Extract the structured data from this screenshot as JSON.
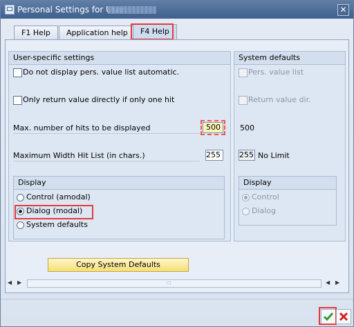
{
  "window": {
    "title": "Personal Settings for User",
    "close_glyph": "✕"
  },
  "tabs": [
    {
      "label": "F1 Help"
    },
    {
      "label": "Application help"
    },
    {
      "label": "F4 Help"
    }
  ],
  "user_settings": {
    "heading": "User-specific settings",
    "no_list_auto": "Do not display pers. value list automatic.",
    "return_directly": "Only return value directly if only one hit",
    "max_hits_label": "Max. number of hits to be displayed",
    "max_hits_value": "500",
    "max_width_label": "Maximum Width Hit List (in chars.)",
    "max_width_value": "255",
    "display": {
      "heading": "Display",
      "options": [
        "Control (amodal)",
        "Dialog (modal)",
        "System defaults"
      ],
      "selected": "Dialog (modal)"
    },
    "copy_button": "Copy System Defaults"
  },
  "system_defaults": {
    "heading": "System defaults",
    "pers_value_list": "Pers. value list",
    "return_value_dir": "Return value dir.",
    "max_hits_value": "500",
    "max_width_value": "255",
    "no_limit": "No Limit",
    "display": {
      "heading": "Display",
      "options": [
        "Control",
        "Dialog"
      ],
      "selected": "Control"
    }
  },
  "footer": {
    "ok_icon": "checkmark-icon",
    "cancel_icon": "cross-icon",
    "ok_color": "#2e9b2e",
    "cancel_color": "#d32020"
  }
}
